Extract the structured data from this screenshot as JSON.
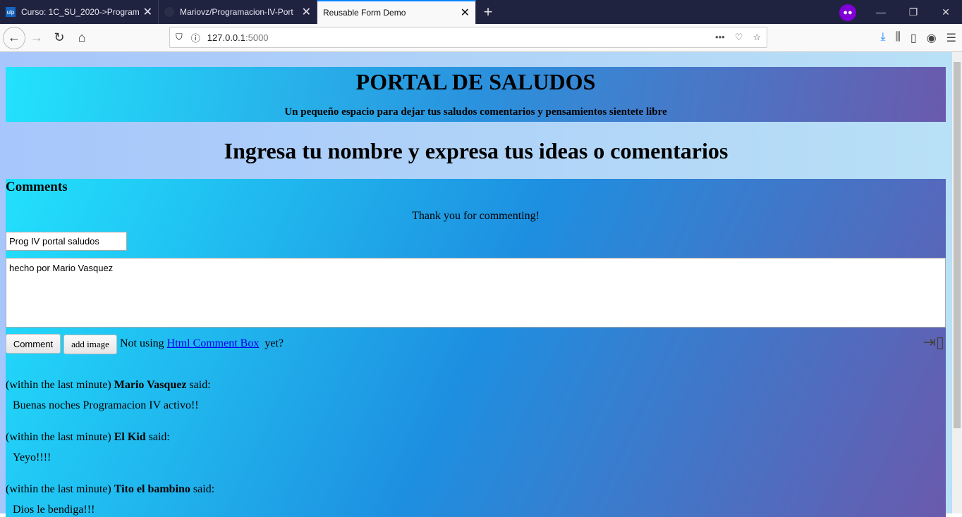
{
  "browser": {
    "tabs": [
      {
        "label": "Curso: 1C_SU_2020->Programa",
        "favicon": "ulp"
      },
      {
        "label": "Mariovz/Programacion-IV-Port"
      },
      {
        "label": "Reusable Form Demo",
        "active": true
      }
    ],
    "url_host": "127.0.0.1",
    "url_port": ":5000"
  },
  "header": {
    "title": "PORTAL DE SALUDOS",
    "subtitle": "Un pequeño espacio para dejar tus saludos comentarios y pensamientos sientete libre"
  },
  "heading": "Ingresa tu nombre y expresa tus ideas o comentarios",
  "comments": {
    "title": "Comments",
    "thanks": "Thank you for commenting!",
    "name_value": "Prog IV portal saludos",
    "text_value": "hecho por Mario Vasquez",
    "comment_button": "Comment",
    "add_image_button": "add image",
    "not_using": "Not using",
    "link": "Html Comment Box",
    "yet": "yet?",
    "items": [
      {
        "time": "(within the last minute)",
        "author": "Mario Vasquez",
        "said": "said:",
        "text": "Buenas noches Programacion IV activo!!"
      },
      {
        "time": "(within the last minute)",
        "author": "El Kid",
        "said": "said:",
        "text": "Yeyo!!!!"
      },
      {
        "time": "(within the last minute)",
        "author": "Tito el bambino",
        "said": "said:",
        "text": "Dios le bendiga!!!"
      }
    ]
  }
}
